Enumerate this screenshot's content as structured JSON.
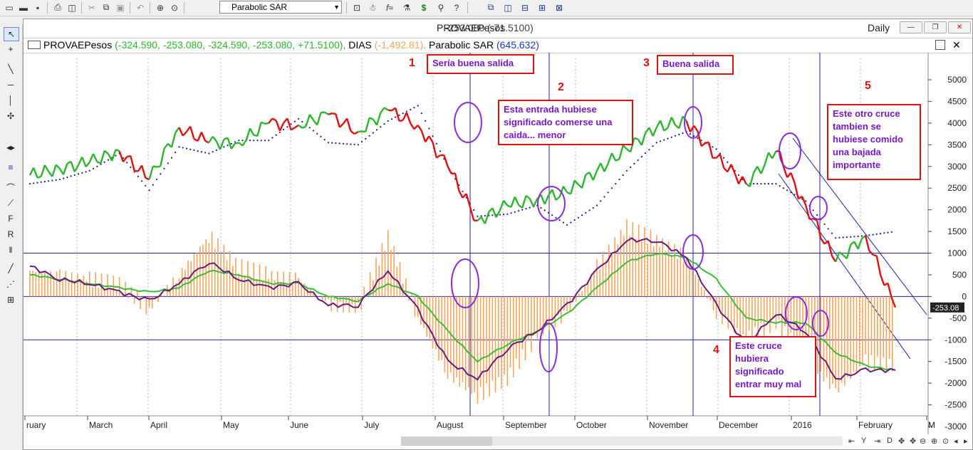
{
  "toolbar": {
    "study_select": "Parabolic SAR"
  },
  "window": {
    "title": "PROVAEPesos",
    "title_overlay": "-253.080 (-71.5100)",
    "period": "Daily",
    "minimize": "—",
    "restore": "❐",
    "close": "✕"
  },
  "legend": {
    "symbol": "PROVAEPesos",
    "values": "(-324.590, -253.080, -324.590, -253.080, +71.5100),",
    "ind1_name": "DIAS",
    "ind1_value": "(-1,492.81),",
    "ind2_name": "Parabolic SAR",
    "ind2_value": "(645.632)"
  },
  "colors": {
    "up": "#2db52d",
    "down": "#e01010",
    "sar": "#1a1a8a",
    "hist": "#f5a45a",
    "sig_purple": "#6a1a7a",
    "sig_green": "#34c234",
    "guide": "#2020a0",
    "annotation": "#7a18c8",
    "annotation_border": "#e01010"
  },
  "annotations": [
    {
      "num": "1",
      "text": "Sería buena salida"
    },
    {
      "num": "2",
      "text": "Esta entrada hubiese significado comerse una caida... menor"
    },
    {
      "num": "3",
      "text": "Buena salida"
    },
    {
      "num": "4",
      "text": "Este cruce hubiera significado entrar muy mal"
    },
    {
      "num": "5",
      "text": "Este otro cruce tambien se hubiese comido una bajada importante"
    }
  ],
  "chart_data": {
    "type": "line",
    "title": "",
    "price_axis": {
      "ticks": [
        5000,
        4500,
        4000,
        3500,
        3000,
        2500,
        2000,
        1500,
        1000,
        500,
        0,
        -500,
        -1000,
        -1500,
        -2000,
        -2500,
        -3000
      ]
    },
    "last_value_label": "-253.08",
    "x_labels": [
      "ruary",
      "March",
      "April",
      "May",
      "June",
      "July",
      "August",
      "September",
      "October",
      "November",
      "December",
      "2016",
      "February",
      "M"
    ],
    "price_series": {
      "name": "PROVAEPesos",
      "x": [
        "Feb",
        "Feb",
        "Mar",
        "Mar",
        "Apr",
        "Apr",
        "May",
        "May",
        "Jun",
        "Jun",
        "Jul",
        "Jul",
        "Aug",
        "Aug",
        "Aug",
        "Sep",
        "Sep",
        "Sep",
        "Oct",
        "Oct",
        "Nov",
        "Nov",
        "Nov",
        "Dec",
        "Dec",
        "Jan",
        "Jan",
        "Jan",
        "Feb",
        "Feb"
      ],
      "values": [
        2800,
        2950,
        3100,
        3350,
        2700,
        3900,
        3550,
        3550,
        4000,
        3950,
        4200,
        3800,
        4300,
        3950,
        3000,
        1750,
        2100,
        2250,
        2400,
        2900,
        3400,
        3900,
        4050,
        3200,
        2600,
        3350,
        2100,
        800,
        1400,
        -253
      ]
    },
    "parabolic_sar": {
      "name": "Parabolic SAR",
      "values": [
        2600,
        2700,
        2900,
        3300,
        2450,
        3450,
        3300,
        3600,
        3600,
        4100,
        3550,
        3500,
        4050,
        4400,
        3000,
        1850,
        1900,
        2100,
        1650,
        2100,
        2900,
        3550,
        3800,
        3400,
        2600,
        2600,
        2200,
        1350,
        1400,
        1500
      ]
    },
    "dias_histogram": {
      "name": "DIAS",
      "values": [
        600,
        500,
        400,
        300,
        -300,
        500,
        1400,
        700,
        500,
        400,
        -200,
        -300,
        1400,
        -500,
        -1800,
        -2300,
        -1900,
        -900,
        -400,
        700,
        1600,
        1300,
        900,
        -400,
        -1000,
        -600,
        -1400,
        -2200,
        -1500,
        -1600
      ]
    },
    "dias_signal_fast": {
      "values": [
        700,
        400,
        300,
        100,
        -100,
        300,
        800,
        400,
        200,
        300,
        -200,
        -200,
        600,
        -300,
        -1500,
        -1900,
        -1200,
        -800,
        -200,
        600,
        1300,
        1300,
        900,
        -200,
        -1100,
        -400,
        -800,
        -1900,
        -1700,
        -1700
      ]
    },
    "dias_signal_slow": {
      "values": [
        500,
        400,
        300,
        200,
        100,
        200,
        600,
        500,
        300,
        300,
        0,
        -100,
        300,
        0,
        -800,
        -1500,
        -1100,
        -800,
        -400,
        200,
        800,
        1000,
        900,
        400,
        -500,
        -600,
        -600,
        -1300,
        -1600,
        -1700
      ]
    },
    "reference_lines": [
      1000,
      0,
      -1000
    ]
  }
}
